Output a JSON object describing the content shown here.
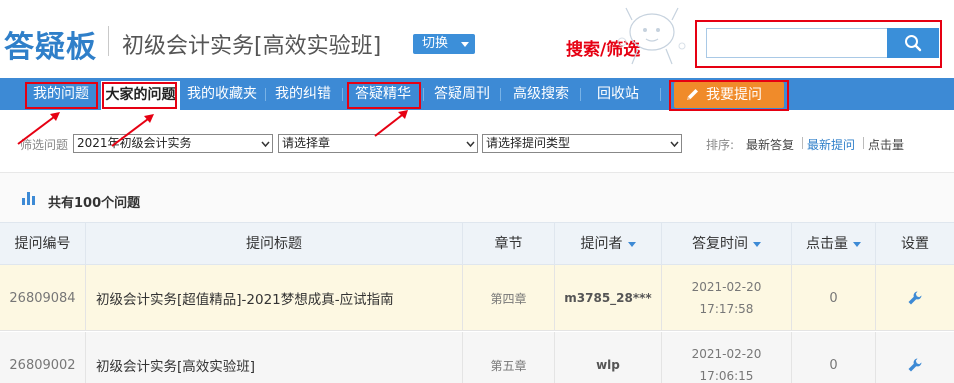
{
  "header": {
    "logo": "答疑板",
    "course_title": "初级会计实务[高效实验班]",
    "switch_label": "切换",
    "annotation": "搜索/筛选",
    "search_placeholder": ""
  },
  "nav": {
    "items": [
      {
        "label": "我的问题"
      },
      {
        "label": "大家的问题",
        "active": true
      },
      {
        "label": "我的收藏夹"
      },
      {
        "label": "我的纠错"
      },
      {
        "label": "答疑精华"
      },
      {
        "label": "答疑周刊"
      },
      {
        "label": "高级搜索"
      },
      {
        "label": "回收站"
      }
    ],
    "ask_label": "我要提问"
  },
  "filter": {
    "label": "筛选问题",
    "course_select": "2021年初级会计实务",
    "chapter_select": "请选择章",
    "type_select": "请选择提问类型",
    "sort_label": "排序:",
    "sort_options": [
      "最新答复",
      "最新提问",
      "点击量"
    ],
    "sort_active": "最新提问"
  },
  "count_text": "共有100个问题",
  "table": {
    "headers": [
      "提问编号",
      "提问标题",
      "章节",
      "提问者",
      "答复时间",
      "点击量",
      "设置"
    ],
    "rows": [
      {
        "id": "26809084",
        "title": "初级会计实务[超值精品]-2021梦想成真-应试指南",
        "chapter": "第四章",
        "user": "m3785_28***",
        "date": "2021-02-20",
        "time": "17:17:58",
        "clicks": "0"
      },
      {
        "id": "26809002",
        "title": "初级会计实务[高效实验班]",
        "chapter": "第五章",
        "user": "wlp",
        "date": "2021-02-20",
        "time": "17:06:15",
        "clicks": "0"
      }
    ]
  },
  "colors": {
    "brand_blue": "#3d8ad5",
    "ask_orange": "#f08b2a",
    "annotation_red": "#e60012"
  }
}
